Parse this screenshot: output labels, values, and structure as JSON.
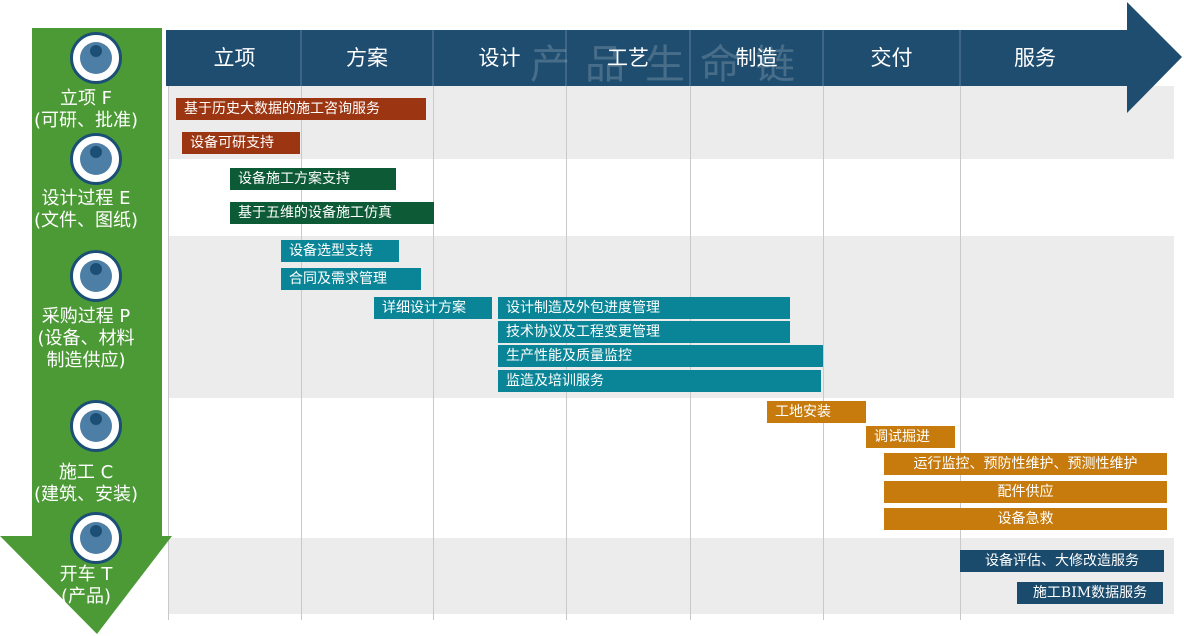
{
  "colors": {
    "header_arrow": "#1f4d70",
    "left_arrow": "#4b9a35",
    "brown": "#9c3512",
    "green": "#0c5a36",
    "teal": "#0a8597",
    "orange": "#c77b0c",
    "navy": "#1a4a6c"
  },
  "phases": [
    "立项",
    "方案",
    "设计",
    "工艺",
    "制造",
    "交付",
    "服务"
  ],
  "watermark": [
    "产",
    "品",
    "生",
    "命",
    "链"
  ],
  "stages": [
    {
      "lines": [
        "立项 F",
        "(可研、批准)"
      ],
      "icon": "globe-icon"
    },
    {
      "lines": [
        "设计过程 E",
        "(文件、图纸)"
      ],
      "icon": "computer-user-icon"
    },
    {
      "lines": [
        "采购过程 P",
        "(设备、材料",
        "制造供应)"
      ],
      "icon": "procurement-icon"
    },
    {
      "lines": [
        "施工 C",
        "(建筑、安装)"
      ],
      "icon": "construction-icon"
    },
    {
      "lines": [
        "开车 T",
        "(产品)"
      ],
      "icon": "operator-icon"
    }
  ],
  "bars": [
    {
      "label": "基于历史大数据的施工咨询服务",
      "color": "brown"
    },
    {
      "label": "设备可研支持",
      "color": "brown"
    },
    {
      "label": "设备施工方案支持",
      "color": "green"
    },
    {
      "label": "基于五维的设备施工仿真",
      "color": "green"
    },
    {
      "label": "设备选型支持",
      "color": "teal"
    },
    {
      "label": "合同及需求管理",
      "color": "teal"
    },
    {
      "label": "详细设计方案",
      "color": "teal"
    },
    {
      "label": "设计制造及外包进度管理",
      "color": "teal"
    },
    {
      "label": "技术协议及工程变更管理",
      "color": "teal"
    },
    {
      "label": "生产性能及质量监控",
      "color": "teal"
    },
    {
      "label": "监造及培训服务",
      "color": "teal"
    },
    {
      "label": "工地安装",
      "color": "orange"
    },
    {
      "label": "调试掘进",
      "color": "orange"
    },
    {
      "label": "运行监控、预防性维护、预测性维护",
      "color": "orange"
    },
    {
      "label": "配件供应",
      "color": "orange"
    },
    {
      "label": "设备急救",
      "color": "orange"
    },
    {
      "label": "设备评估、大修改造服务",
      "color": "navy"
    },
    {
      "label": "施工BIM数据服务",
      "color": "navy"
    }
  ]
}
